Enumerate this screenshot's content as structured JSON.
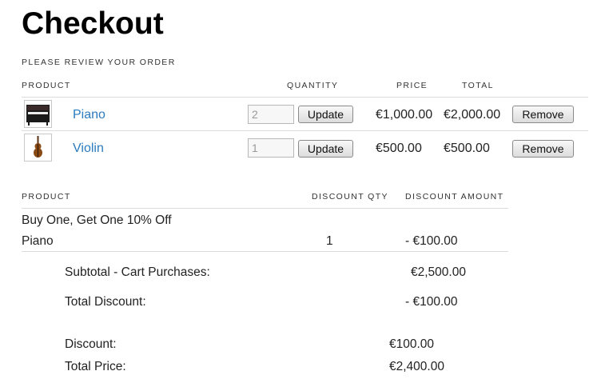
{
  "page": {
    "title": "Checkout",
    "subtitle": "PLEASE REVIEW YOUR ORDER"
  },
  "cart": {
    "headers": {
      "product": "PRODUCT",
      "quantity": "QUANTITY",
      "price": "PRICE",
      "total": "TOTAL"
    },
    "items": [
      {
        "name": "Piano",
        "quantity": "2",
        "price": "€1,000.00",
        "total": "€2,000.00",
        "update_label": "Update",
        "remove_label": "Remove",
        "image_icon": "piano-icon"
      },
      {
        "name": "Violin",
        "quantity": "1",
        "price": "€500.00",
        "total": "€500.00",
        "update_label": "Update",
        "remove_label": "Remove",
        "image_icon": "violin-icon"
      }
    ]
  },
  "discounts": {
    "headers": {
      "product": "PRODUCT",
      "discount_qty": "DISCOUNT QTY",
      "discount_amount": "DISCOUNT AMOUNT"
    },
    "promotion": "Buy One, Get One 10% Off",
    "rows": [
      {
        "product": "Piano",
        "qty": "1",
        "amount": "- €100.00"
      }
    ]
  },
  "summary": {
    "subtotal_label": "Subtotal - Cart Purchases:",
    "subtotal_value": "€2,500.00",
    "total_discount_label": "Total Discount:",
    "total_discount_value": "- €100.00",
    "discount_label": "Discount:",
    "discount_value": "€100.00",
    "total_price_label": "Total Price:",
    "total_price_value": "€2,400.00"
  }
}
